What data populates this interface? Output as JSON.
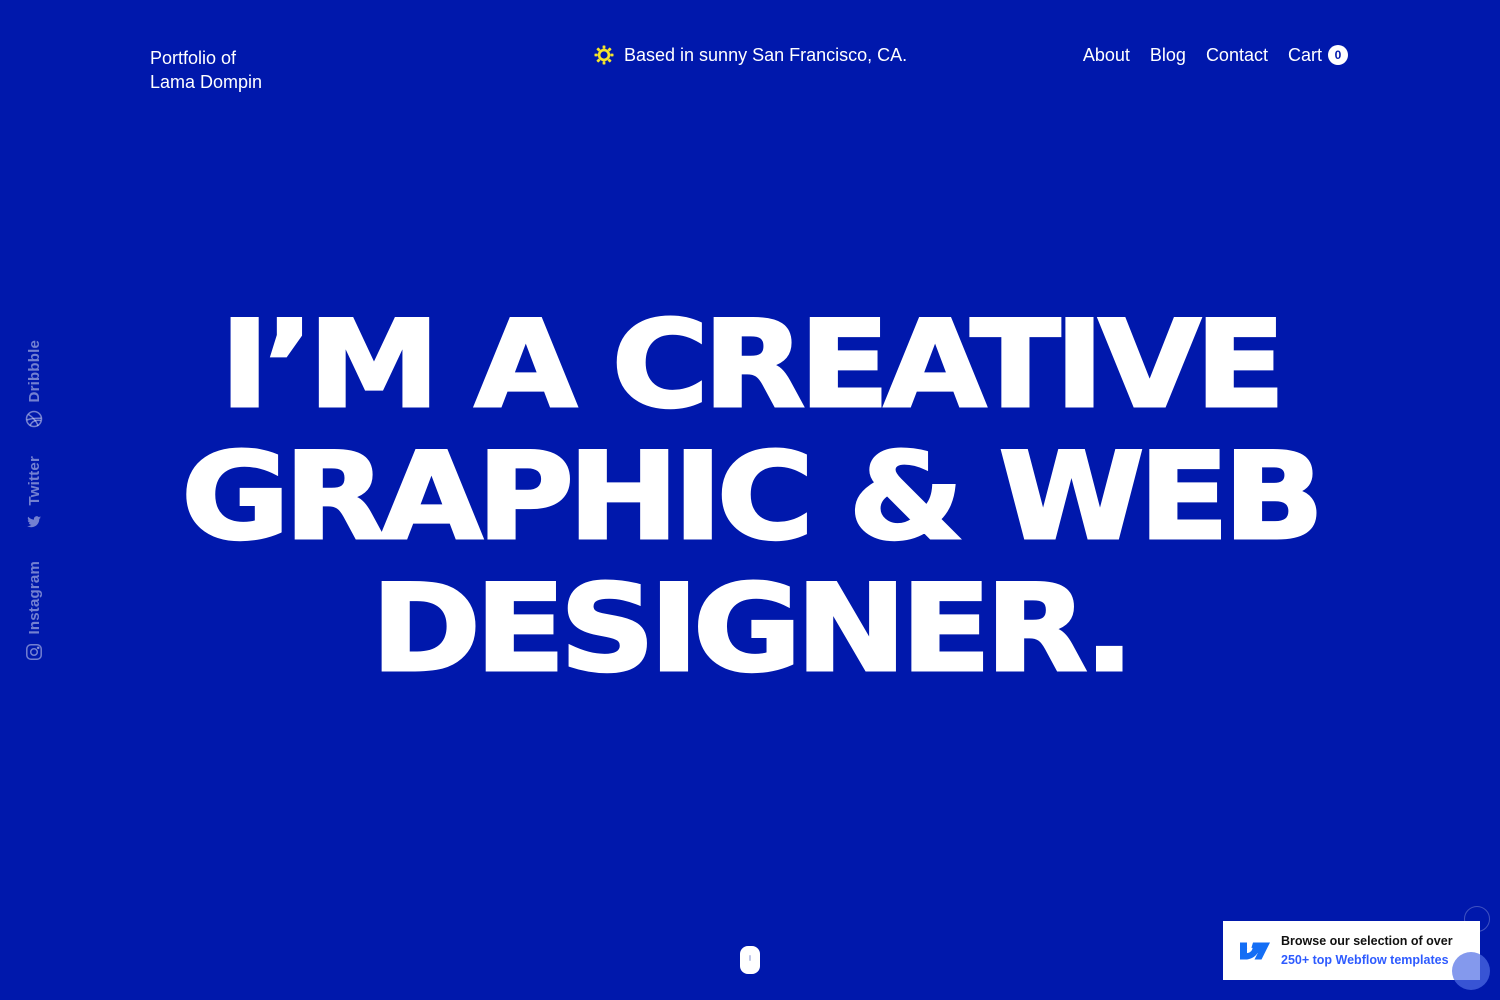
{
  "brand": {
    "line1": "Portfolio of",
    "line2": "Lama Dompin"
  },
  "location": {
    "icon": "sun-icon",
    "text": "Based in sunny San Francisco, CA."
  },
  "nav": {
    "items": [
      "About",
      "Blog",
      "Contact"
    ],
    "cart_label": "Cart",
    "cart_count": "0"
  },
  "social": [
    {
      "label": "Dribbble",
      "icon": "dribbble-icon"
    },
    {
      "label": "Twitter",
      "icon": "twitter-icon"
    },
    {
      "label": "Instagram",
      "icon": "instagram-icon"
    }
  ],
  "hero": {
    "lines": [
      "I’M A CREATIVE",
      "GRAPHIC & WEB",
      "DESIGNER."
    ]
  },
  "banner": {
    "line1": "Browse our selection of over",
    "line2": "250+ top Webflow templates"
  },
  "colors": {
    "background": "#0018AC",
    "text": "#FFFFFF",
    "sun": "#F5E52B",
    "banner_link": "#2E5BFF",
    "webflow_logo": "#146EF5"
  }
}
